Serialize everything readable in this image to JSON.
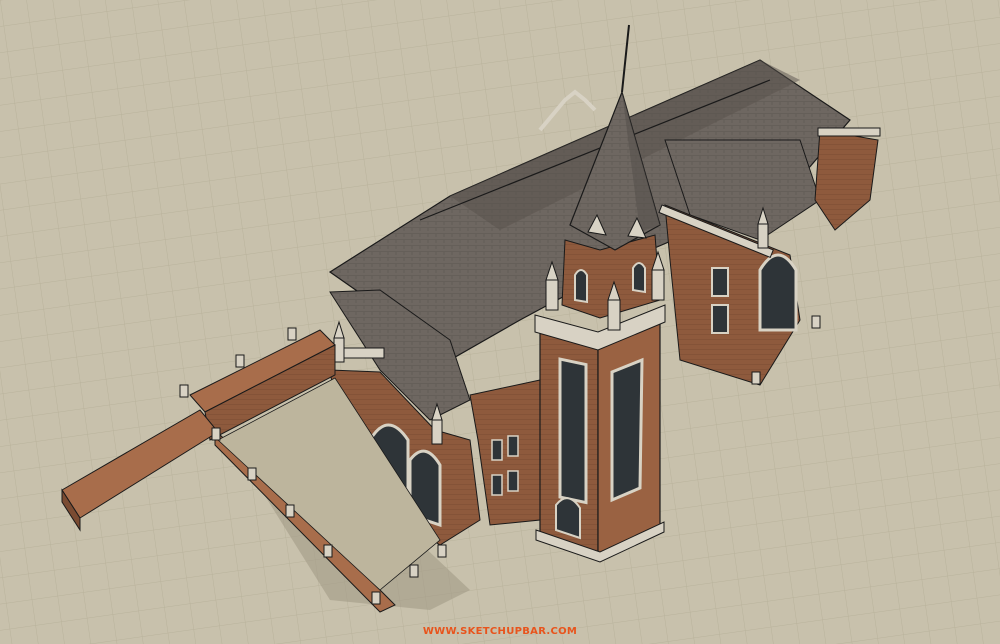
{
  "image": {
    "subject": "sketchup-model-render",
    "watermark_text": "WWW.SKETCHUPBAR.COM",
    "colors": {
      "ground": "#c8c1ac",
      "ground_tile_line": "#b6ae97",
      "roof": "#6e6761",
      "roof_dark": "#57514c",
      "brick": "#8e5a3d",
      "brick_light": "#a86d4b",
      "trim": "#d8d2c4",
      "window": "#2e3438",
      "outline": "#1a1a1a",
      "watermark": "#e8541c"
    }
  }
}
